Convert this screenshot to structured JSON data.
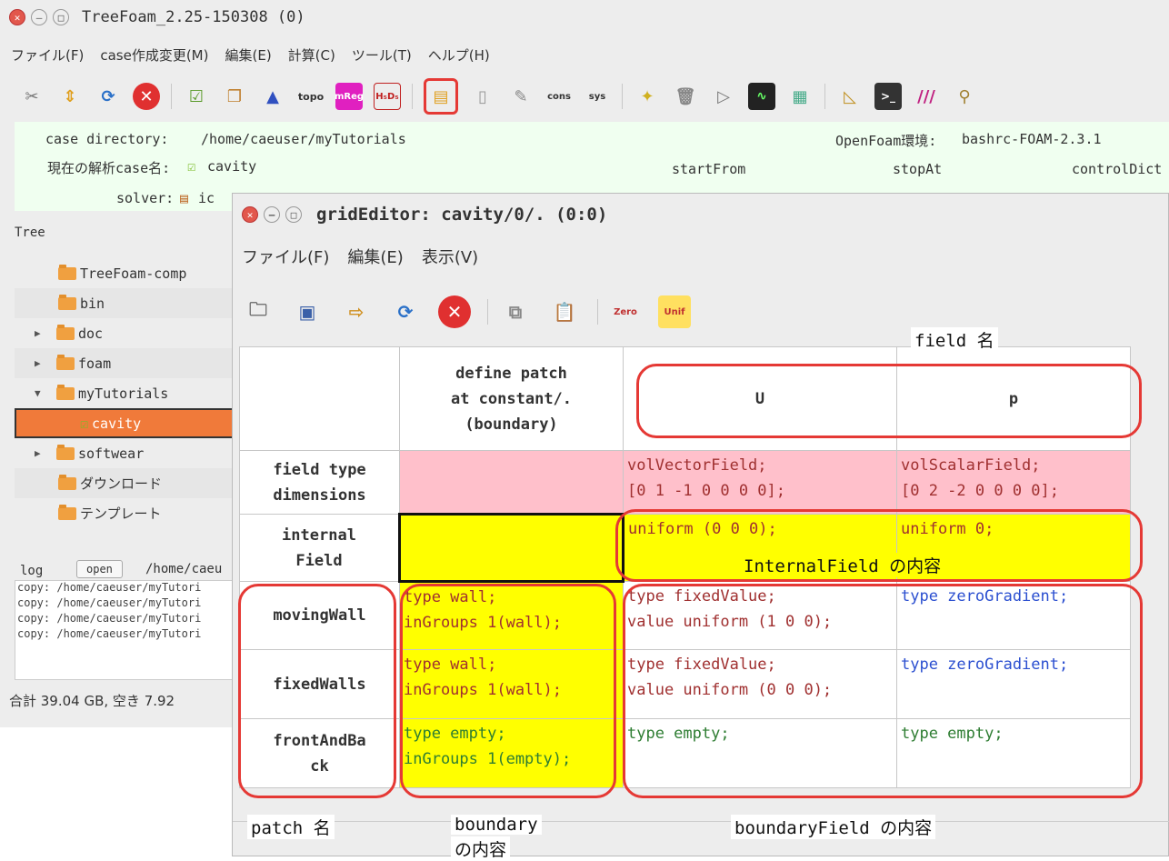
{
  "main_window": {
    "title": "TreeFoam_2.25-150308 (0)",
    "menu": [
      "ファイル(F)",
      "case作成変更(M)",
      "編集(E)",
      "計算(C)",
      "ツール(T)",
      "ヘルプ(H)"
    ],
    "toolbar_icons": [
      "tools-icon",
      "up-down-icon",
      "refresh-icon",
      "stop-icon",
      "check-doc-icon",
      "copy-doc-icon",
      "mesh-icon",
      "topo-icon",
      "mreg-icon",
      "hdf-icon",
      "grid-editor-icon",
      "doc-icon",
      "edit-doc-icon",
      "cons-icon",
      "sys-icon",
      "star-icon",
      "trash-icon",
      "play-icon",
      "monitor-icon",
      "layout-icon",
      "triangle-icon",
      "terminal-icon",
      "paraview-icon",
      "extra-icon"
    ],
    "toolbar_text": {
      "topo": "topo",
      "mreg": "mReg",
      "hdf": "H₅D₅"
    },
    "case_directory_label": "case directory:",
    "case_directory": "/home/caeuser/myTutorials",
    "openfoam_env_label": "OpenFoam環境:",
    "openfoam_env": "bashrc-FOAM-2.3.1",
    "current_case_label": "現在の解析case名:",
    "current_case": "cavity",
    "start_from": "startFrom",
    "stop_at": "stopAt",
    "control_dict": "controlDict",
    "solver_label": "solver:",
    "solver_value": "ic",
    "tree_label": "Tree",
    "tree": [
      {
        "label": "TreeFoam-comp",
        "arrow": ""
      },
      {
        "label": "bin",
        "arrow": ""
      },
      {
        "label": "doc",
        "arrow": "▶"
      },
      {
        "label": "foam",
        "arrow": "▶"
      },
      {
        "label": "myTutorials",
        "arrow": "▼"
      },
      {
        "label": "cavity",
        "arrow": ""
      },
      {
        "label": "softwear",
        "arrow": "▶"
      },
      {
        "label": "ダウンロード",
        "arrow": ""
      },
      {
        "label": "テンプレート",
        "arrow": ""
      }
    ],
    "log_label": "log",
    "log_open": "open",
    "log_path": "/home/caeu",
    "log_lines": [
      "copy: /home/caeuser/myTutori",
      "copy: /home/caeuser/myTutori",
      "copy: /home/caeuser/myTutori",
      "copy: /home/caeuser/myTutori"
    ],
    "status": "合計 39.04 GB,  空き 7.92"
  },
  "grid_editor": {
    "title": "gridEditor: cavity/0/. (0:0)",
    "menu": [
      "ファイル(F)",
      "編集(E)",
      "表示(V)"
    ],
    "toolbar_icons": [
      "open-icon",
      "save-icon",
      "export-icon",
      "refresh-icon",
      "stop-icon",
      "copy-icon",
      "paste-icon",
      "zero-icon",
      "unif-icon"
    ],
    "toolbar_text": {
      "zero": "Zero",
      "unif": "Unif"
    },
    "header": {
      "col0": "",
      "col1": [
        "define patch",
        "at constant/.",
        "(boundary)"
      ],
      "col2": "U",
      "col3": "p"
    },
    "rows": [
      {
        "name": [
          "field type",
          "dimensions"
        ],
        "boundary": [],
        "U": [
          "volVectorField;",
          "[0 1 -1 0 0 0 0];"
        ],
        "p": [
          "volScalarField;",
          "[0 2 -2 0 0 0 0];"
        ],
        "style": "pink"
      },
      {
        "name": [
          "internal",
          "Field"
        ],
        "boundary": [],
        "U": [
          "uniform (0 0 0);"
        ],
        "p": [
          "uniform 0;"
        ],
        "style": "yellow"
      },
      {
        "name": [
          "movingWall"
        ],
        "boundary": [
          "type wall;",
          "inGroups 1(wall);"
        ],
        "U": [
          "type fixedValue;",
          "value uniform (1 0 0);"
        ],
        "p": [
          "type zeroGradient;"
        ],
        "style": "bc"
      },
      {
        "name": [
          "fixedWalls"
        ],
        "boundary": [
          "type wall;",
          "inGroups 1(wall);"
        ],
        "U": [
          "type fixedValue;",
          "value uniform (0 0 0);"
        ],
        "p": [
          "type zeroGradient;"
        ],
        "style": "bc"
      },
      {
        "name": [
          "frontAndBa",
          "ck"
        ],
        "boundary": [
          "type empty;",
          "inGroups 1(empty);"
        ],
        "U": [
          "type empty;"
        ],
        "p": [
          "type empty;"
        ],
        "style": "bc"
      }
    ]
  },
  "annotations": {
    "field_name": "field 名",
    "internal_field": "InternalField の内容",
    "patch_name": "patch 名",
    "boundary_content_1": "boundary",
    "boundary_content_2": "の内容",
    "boundary_field": "boundaryField の内容"
  },
  "colors": {
    "pink_cell": "#ffc0cb",
    "yellow_cell": "#ffff00",
    "selection": "#f07a3a",
    "annotation_ring": "#e53935",
    "case_panel_bg": "#f0fff0"
  }
}
